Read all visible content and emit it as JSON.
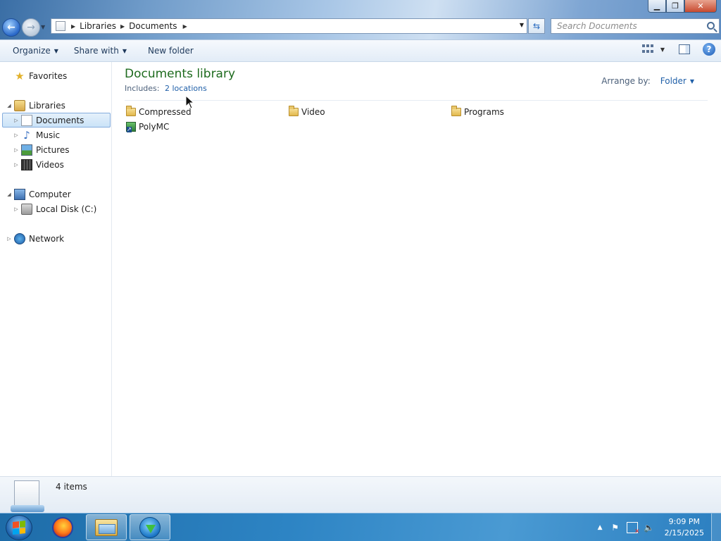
{
  "window": {
    "minimize_label": "▁",
    "maximize_label": "❐",
    "close_label": "✕"
  },
  "address": {
    "crumbs": [
      "Libraries",
      "Documents"
    ]
  },
  "search": {
    "placeholder": "Search Documents"
  },
  "toolbar": {
    "organize": "Organize",
    "share_with": "Share with",
    "new_folder": "New folder"
  },
  "nav": {
    "favorites": "Favorites",
    "libraries": "Libraries",
    "documents": "Documents",
    "music": "Music",
    "pictures": "Pictures",
    "videos": "Videos",
    "computer": "Computer",
    "local_disk": "Local Disk (C:)",
    "network": "Network"
  },
  "library": {
    "title": "Documents library",
    "includes_label": "Includes:",
    "locations_link": "2 locations",
    "arrange_label": "Arrange by:",
    "arrange_value": "Folder"
  },
  "items": [
    {
      "name": "Compressed",
      "type": "folder"
    },
    {
      "name": "Video",
      "type": "folder"
    },
    {
      "name": "Programs",
      "type": "folder"
    },
    {
      "name": "PolyMC",
      "type": "shortcut"
    }
  ],
  "details": {
    "count": "4 items"
  },
  "taskbar": {
    "apps": [
      "firefox-icon",
      "windows-explorer-icon",
      "internet-download-manager-icon"
    ],
    "time": "9:09 PM",
    "date": "2/15/2025"
  },
  "icons": {
    "favorites": "star-icon",
    "libraries": "libraries-icon",
    "documents": "document-icon",
    "music": "music-note-icon",
    "pictures": "pictures-icon",
    "videos": "film-icon",
    "computer": "computer-icon",
    "local_disk": "hard-disk-icon",
    "network": "network-globe-icon"
  },
  "colors": {
    "library_title": "#1e6b1e",
    "link": "#1f5fa8",
    "taskbar": "#2d84c4"
  }
}
